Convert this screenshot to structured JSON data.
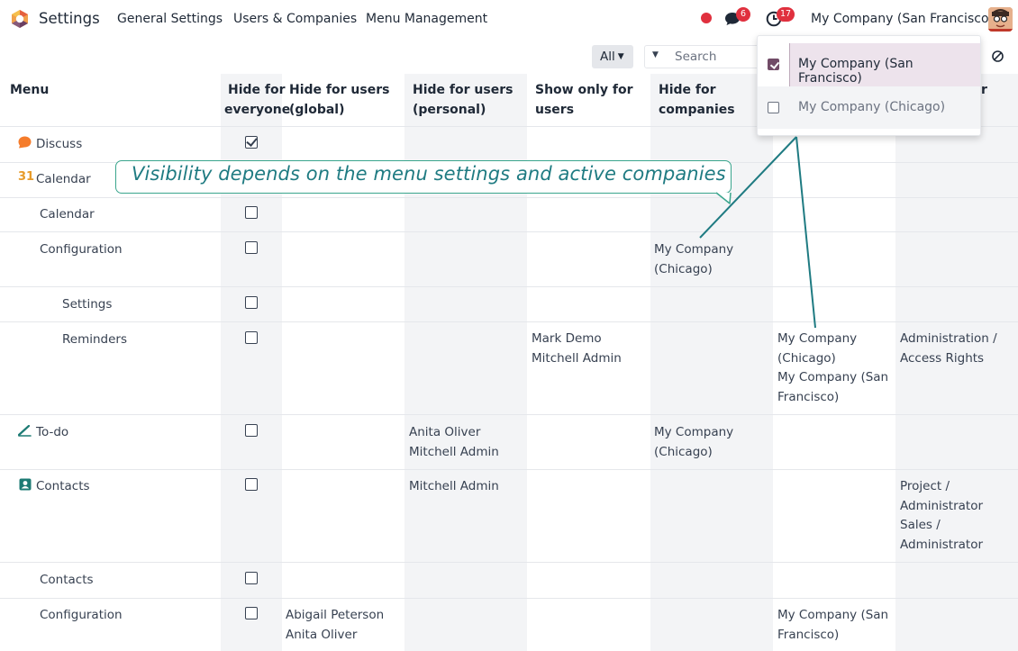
{
  "navbar": {
    "app_name": "Settings",
    "links": [
      "General Settings",
      "Users & Companies",
      "Menu Management"
    ],
    "messages_count": "6",
    "activities_count": "17",
    "current_company": "My Company (San Francisco)"
  },
  "search": {
    "filter_label": "All",
    "placeholder": "Search"
  },
  "table": {
    "headers": {
      "menu": "Menu",
      "hide_everyone": [
        "Hide for",
        "everyone"
      ],
      "hide_global": [
        "Hide for users",
        "(global)"
      ],
      "hide_personal": [
        "Hide for users",
        "(personal)"
      ],
      "show_only": [
        "Show only for",
        "users"
      ],
      "hide_companies": [
        "Hide for",
        "companies"
      ],
      "col7_partial": "r"
    },
    "rows": [
      {
        "menu": "Discuss",
        "hide_everyone": true,
        "global": [],
        "personal": [],
        "show_only": [],
        "hide_companies": [],
        "show_only_companies": [],
        "groups": []
      },
      {
        "menu": "Calendar",
        "hide_everyone": false,
        "global": [],
        "personal": [],
        "show_only": [],
        "hide_companies": [],
        "show_only_companies": [],
        "groups": []
      },
      {
        "menu": "Calendar",
        "hide_everyone": false,
        "global": [],
        "personal": [],
        "show_only": [],
        "hide_companies": [],
        "show_only_companies": [],
        "groups": []
      },
      {
        "menu": "Configuration",
        "hide_everyone": false,
        "global": [],
        "personal": [],
        "show_only": [],
        "hide_companies": [
          "My Company",
          "(Chicago)"
        ],
        "show_only_companies": [],
        "groups": []
      },
      {
        "menu": "Settings",
        "hide_everyone": false,
        "global": [],
        "personal": [],
        "show_only": [],
        "hide_companies": [],
        "show_only_companies": [],
        "groups": []
      },
      {
        "menu": "Reminders",
        "hide_everyone": false,
        "global": [],
        "personal": [],
        "show_only": [
          "Mark Demo",
          "Mitchell Admin"
        ],
        "hide_companies": [],
        "show_only_companies": [
          "My Company",
          "(Chicago)",
          "My Company (San",
          "Francisco)"
        ],
        "groups": [
          "Administration /",
          "Access Rights"
        ]
      },
      {
        "menu": "To-do",
        "hide_everyone": false,
        "global": [],
        "personal": [
          "Anita Oliver",
          "Mitchell Admin"
        ],
        "show_only": [],
        "hide_companies": [
          "My Company",
          "(Chicago)"
        ],
        "show_only_companies": [],
        "groups": []
      },
      {
        "menu": "Contacts",
        "hide_everyone": false,
        "global": [],
        "personal": [
          "Mitchell Admin"
        ],
        "show_only": [],
        "hide_companies": [],
        "show_only_companies": [],
        "groups": [
          "Project /",
          "Administrator",
          "Sales /",
          "Administrator"
        ]
      },
      {
        "menu": "Contacts",
        "hide_everyone": false,
        "global": [],
        "personal": [],
        "show_only": [],
        "hide_companies": [],
        "show_only_companies": [],
        "groups": []
      },
      {
        "menu": "Configuration",
        "hide_everyone": false,
        "global": [
          "Abigail Peterson",
          "Anita Oliver"
        ],
        "personal": [],
        "show_only": [],
        "hide_companies": [],
        "show_only_companies": [
          "My Company (San",
          "Francisco)"
        ],
        "groups": []
      }
    ]
  },
  "company_dropdown": {
    "items": [
      {
        "label": "My Company (San Francisco)",
        "checked": true
      },
      {
        "label": "My Company (Chicago)",
        "checked": false
      }
    ]
  },
  "callout": {
    "text": "Visibility depends on the menu settings and active companies"
  },
  "colors": {
    "accent": "#714b67",
    "badge": "#e0303e",
    "callout": "#1f7b82",
    "column_shade": "#f3f4f6"
  },
  "icons": {
    "discuss": "discuss-app-icon",
    "calendar": "calendar-app-icon",
    "todo": "todo-app-icon",
    "contacts": "contacts-app-icon"
  }
}
